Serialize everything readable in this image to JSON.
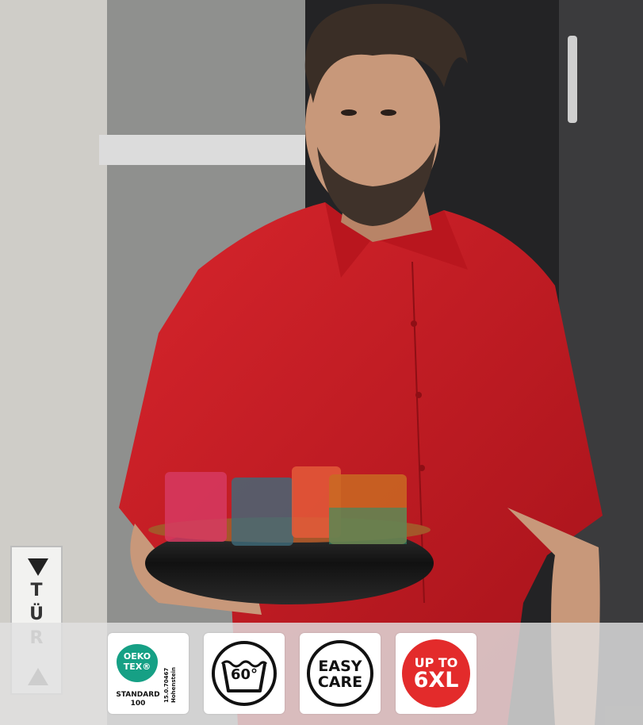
{
  "photo": {
    "subject": "man-in-red-short-sleeve-shirt-carrying-tray-of-glasses",
    "colors": {
      "shirt": "#c81a22",
      "wall": "#c9c7c2",
      "dark_door": "#2a2a2c",
      "skin": "#c8987a",
      "hair": "#3a2e26"
    }
  },
  "door_sign": {
    "letters": [
      "T",
      "Ü",
      "R"
    ]
  },
  "badges": {
    "oeko": {
      "logo_line1": "OEKO",
      "logo_line2": "TEX®",
      "standard": "STANDARD",
      "number": "100",
      "cert": "15.0.70467",
      "institute": "Hohenstein",
      "color": "#16a085"
    },
    "wash": {
      "temperature": "60°",
      "icon": "wash-60-icon"
    },
    "easy": {
      "line1": "EASY",
      "line2": "CARE",
      "icon": "easy-care-icon"
    },
    "size": {
      "line1": "UP TO",
      "line2": "6XL",
      "color": "#e32b2b"
    }
  }
}
